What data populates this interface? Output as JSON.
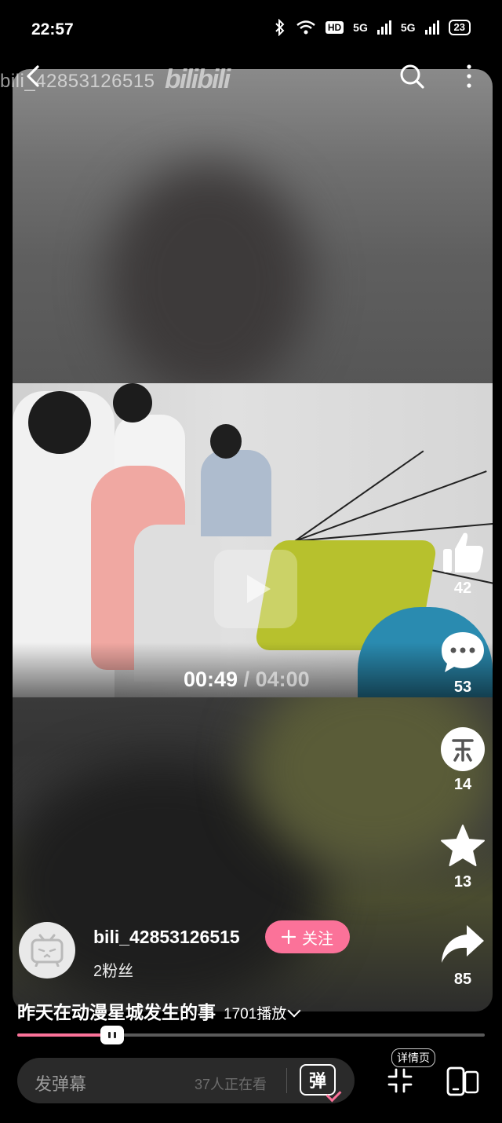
{
  "status_bar": {
    "time": "22:57",
    "hd_label": "HD",
    "network_1": "5G",
    "network_2": "5G",
    "battery": "23"
  },
  "top_bar": {
    "uploader_watermark": "bili_42853126515",
    "logo_text": "bilibili"
  },
  "video": {
    "current_time": "00:49",
    "separator": " / ",
    "duration": "04:00",
    "progress": 0.205
  },
  "actions": {
    "like_count": "42",
    "comment_count": "53",
    "coin_count": "14",
    "favorite_count": "13",
    "share_count": "85"
  },
  "uploader": {
    "name": "bili_42853126515",
    "fans": "2粉丝",
    "follow_label": "关注"
  },
  "info": {
    "title": "昨天在动漫星城发生的事",
    "play_count": "1701播放"
  },
  "bottom_bar": {
    "danmaku_placeholder": "发弹幕",
    "viewers": "37人正在看",
    "danmaku_toggle_label": "弹",
    "detail_label": "详情页"
  },
  "colors": {
    "accent": "#fb7299",
    "background": "#000000"
  }
}
